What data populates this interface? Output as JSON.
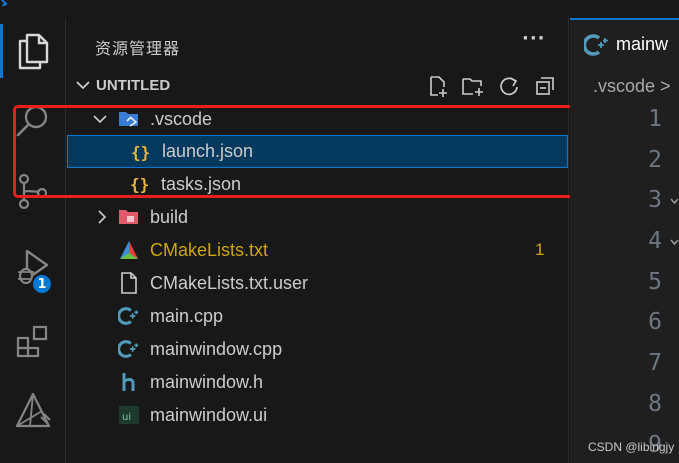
{
  "colors": {
    "accent": "#0078d4",
    "selection": "#04395e",
    "modified": "#cca700",
    "highlight_box": "#e8201d",
    "cpp_icon": "#519aba",
    "json_icon": "#e8b63e",
    "cmake_icon": "#e8403a",
    "folder_build": "#e05a6a"
  },
  "activity_bar": {
    "items": [
      {
        "name": "explorer",
        "icon": "files-icon"
      },
      {
        "name": "search",
        "icon": "search-icon"
      },
      {
        "name": "source-control",
        "icon": "source-control-icon"
      },
      {
        "name": "run-debug",
        "icon": "run-debug-icon",
        "badge": "1"
      },
      {
        "name": "extensions",
        "icon": "extensions-icon"
      },
      {
        "name": "cmake",
        "icon": "cmake-icon"
      }
    ]
  },
  "sidebar": {
    "title": "资源管理器",
    "more": "···",
    "section": {
      "name": "UNTITLED",
      "tools": [
        "new-file-icon",
        "new-folder-icon",
        "refresh-icon",
        "collapse-all-icon"
      ]
    },
    "tree": [
      {
        "label": ".vscode",
        "type": "folder",
        "expanded": true,
        "icon": "vscode-folder-icon"
      },
      {
        "label": "launch.json",
        "type": "file",
        "icon": "json-icon",
        "selected": true
      },
      {
        "label": "tasks.json",
        "type": "file",
        "icon": "json-icon"
      },
      {
        "label": "build",
        "type": "folder",
        "expanded": false,
        "icon": "build-folder-icon"
      },
      {
        "label": "CMakeLists.txt",
        "type": "file",
        "icon": "cmake-file-icon",
        "modified": true,
        "count": "1"
      },
      {
        "label": "CMakeLists.txt.user",
        "type": "file",
        "icon": "file-icon"
      },
      {
        "label": "main.cpp",
        "type": "file",
        "icon": "cpp-icon"
      },
      {
        "label": "mainwindow.cpp",
        "type": "file",
        "icon": "cpp-icon"
      },
      {
        "label": "mainwindow.h",
        "type": "file",
        "icon": "header-icon"
      },
      {
        "label": "mainwindow.ui",
        "type": "file",
        "icon": "ui-file-icon"
      }
    ]
  },
  "editor": {
    "tab_label": "mainw",
    "breadcrumb": ".vscode >",
    "line_numbers": [
      "1",
      "2",
      "3",
      "4",
      "5",
      "6",
      "7",
      "8",
      "9"
    ]
  },
  "watermark": "CSDN @libingjy"
}
